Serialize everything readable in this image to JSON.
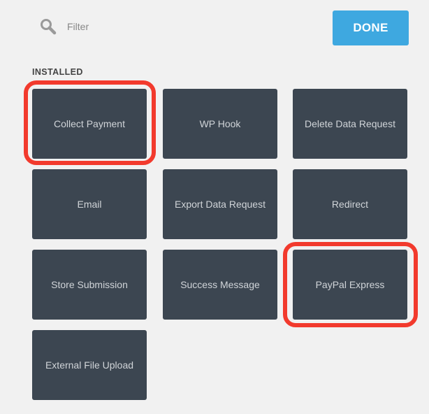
{
  "search": {
    "placeholder": "Filter",
    "icon": "search-icon"
  },
  "toolbar": {
    "done_label": "DONE",
    "done_color": "#3ea8e0"
  },
  "section": {
    "label": "INSTALLED"
  },
  "actions": [
    {
      "label": "Collect Payment",
      "highlighted": true
    },
    {
      "label": "WP Hook",
      "highlighted": false
    },
    {
      "label": "Delete Data Request",
      "highlighted": false
    },
    {
      "label": "Email",
      "highlighted": false
    },
    {
      "label": "Export Data Request",
      "highlighted": false
    },
    {
      "label": "Redirect",
      "highlighted": false
    },
    {
      "label": "Store Submission",
      "highlighted": false
    },
    {
      "label": "Success Message",
      "highlighted": false
    },
    {
      "label": "PayPal Express",
      "highlighted": true
    },
    {
      "label": "External File Upload",
      "highlighted": false
    }
  ],
  "colors": {
    "background": "#f1f1f1",
    "tile": "#3c4651",
    "tile_text": "#d0d4d8",
    "highlight": "#f23a2d"
  }
}
